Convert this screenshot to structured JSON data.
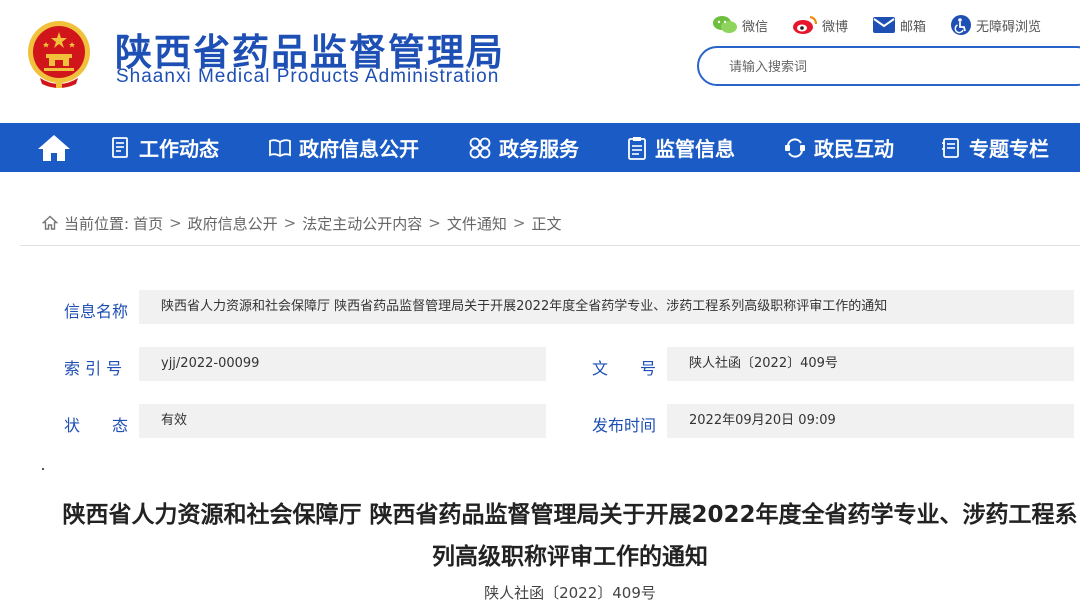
{
  "header": {
    "title": "陕西省药品监督管理局",
    "title_en": "Shaanxi Medical Products Administration",
    "links": [
      {
        "label": "微信",
        "icon": "wechat-icon"
      },
      {
        "label": "微博",
        "icon": "weibo-icon"
      },
      {
        "label": "邮箱",
        "icon": "mail-icon"
      },
      {
        "label": "无障碍浏览",
        "icon": "accessibility-icon"
      }
    ],
    "search_placeholder": "请输入搜索词"
  },
  "nav": {
    "items": [
      {
        "label": "工作动态",
        "icon": "document-list-icon"
      },
      {
        "label": "政府信息公开",
        "icon": "open-book-icon"
      },
      {
        "label": "政务服务",
        "icon": "grid-circles-icon"
      },
      {
        "label": "监管信息",
        "icon": "clipboard-icon"
      },
      {
        "label": "政民互动",
        "icon": "interaction-icon"
      },
      {
        "label": "专题专栏",
        "icon": "notebook-icon"
      }
    ]
  },
  "breadcrumb": {
    "prefix": "当前位置:",
    "items": [
      "首页",
      "政府信息公开",
      "法定主动公开内容",
      "文件通知",
      "正文"
    ],
    "separator": ">"
  },
  "info": {
    "name_label": "信息名称",
    "name_value": "陕西省人力资源和社会保障厅 陕西省药品监督管理局关于开展2022年度全省药学专业、涉药工程系列高级职称评审工作的通知",
    "index_label": "索 引 号",
    "index_value": "yjj/2022-00099",
    "doc_label": "文　　号",
    "doc_value": "陕人社函〔2022〕409号",
    "status_label": "状　　态",
    "status_value": "有效",
    "date_label": "发布时间",
    "date_value": "2022年09月20日 09:09"
  },
  "article": {
    "title": "陕西省人力资源和社会保障厅 陕西省药品监督管理局关于开展2022年度全省药学专业、涉药工程系列高级职称评审工作的通知",
    "doc_number": "陕人社函〔2022〕409号"
  },
  "colors": {
    "brand_blue": "#1e4fb4",
    "nav_blue": "#1a5bc6",
    "emblem_red": "#d0161b",
    "emblem_gold": "#f2c13b"
  }
}
